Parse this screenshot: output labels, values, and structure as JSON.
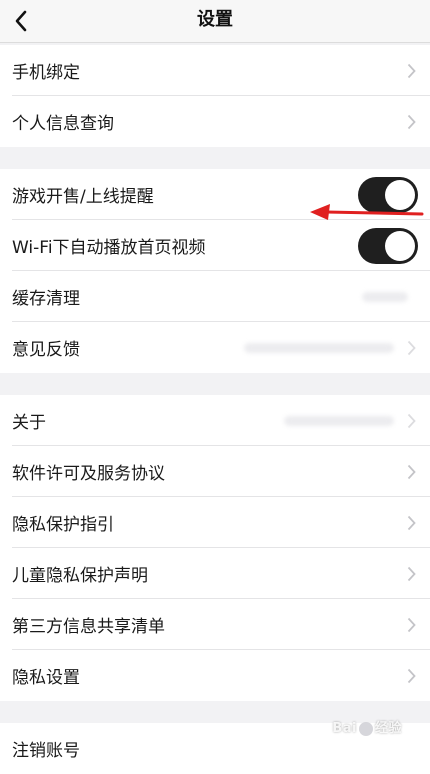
{
  "header": {
    "title": "设置"
  },
  "group1": [
    {
      "label": "手机绑定"
    },
    {
      "label": "个人信息查询"
    }
  ],
  "group2": [
    {
      "label": "游戏开售/上线提醒",
      "toggle": true
    },
    {
      "label": "Wi-Fi下自动播放首页视频",
      "toggle": true
    },
    {
      "label": "缓存清理"
    },
    {
      "label": "意见反馈"
    }
  ],
  "group3": [
    {
      "label": "关于"
    },
    {
      "label": "软件许可及服务协议"
    },
    {
      "label": "隐私保护指引"
    },
    {
      "label": "儿童隐私保护声明"
    },
    {
      "label": "第三方信息共享清单"
    },
    {
      "label": "隐私设置"
    }
  ],
  "group4": [
    {
      "label": "注销账号"
    }
  ],
  "annotation": {
    "arrow_color": "#e02020"
  },
  "colors": {
    "toggle_on": "#1f1f1f",
    "background": "#f2f2f4"
  },
  "watermark": {
    "text_left": "Bai",
    "text_right": "经验"
  }
}
